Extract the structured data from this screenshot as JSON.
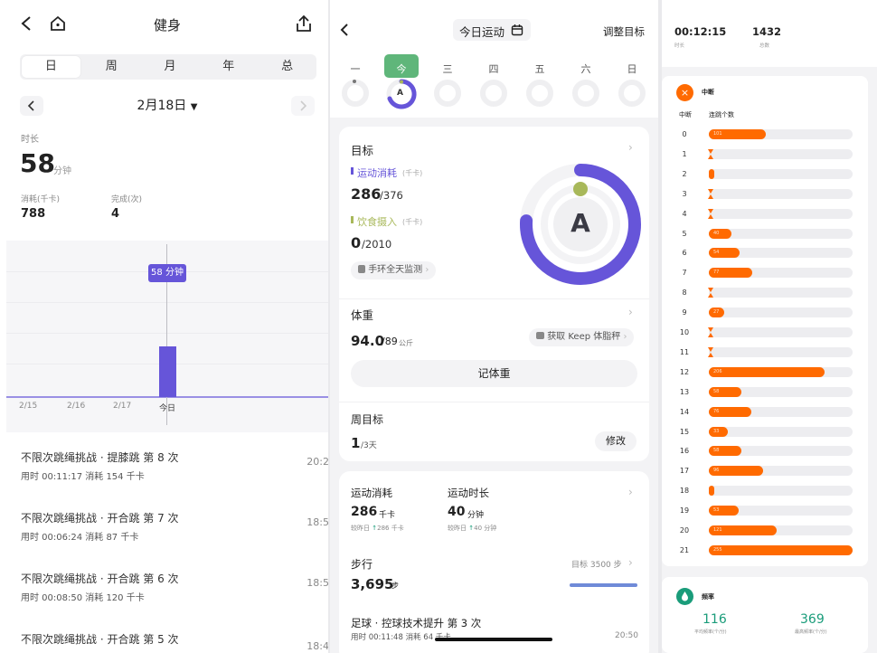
{
  "p1": {
    "title": "健身",
    "tabs": [
      "日",
      "周",
      "月",
      "年",
      "总"
    ],
    "date": "2月18日",
    "duration_label": "时长",
    "duration_value": "58",
    "duration_unit": "分钟",
    "kcal_label": "消耗(千卡)",
    "kcal_value": "788",
    "done_label": "完成(次)",
    "done_value": "4",
    "tooltip": "58 分钟",
    "x_labels": [
      "2/15",
      "2/16",
      "2/17",
      "今日"
    ],
    "records": [
      {
        "title": "不限次跳绳挑战 · 提膝跳 第 8 次",
        "sub": "用时 00:11:17    消耗 154 千卡",
        "time": "20:28"
      },
      {
        "title": "不限次跳绳挑战 · 开合跳 第 7 次",
        "sub": "用时 00:06:24    消耗 87 千卡",
        "time": "18:56"
      },
      {
        "title": "不限次跳绳挑战 · 开合跳 第 6 次",
        "sub": "用时 00:08:50    消耗 120 千卡",
        "time": "18:50"
      },
      {
        "title": "不限次跳绳挑战 · 开合跳 第 5 次",
        "sub": "",
        "time": "18:40"
      }
    ]
  },
  "p2": {
    "title": "今日运动",
    "adjust": "调整目标",
    "weekdays": [
      "一",
      "今",
      "三",
      "四",
      "五",
      "六",
      "日"
    ],
    "ring_letter": "A",
    "goal_title": "目标",
    "burn_label": "运动消耗",
    "burn_unit": "(千卡)",
    "burn_value": "286",
    "burn_target": "/376",
    "intake_label": "饮食摄入",
    "intake_unit": "(千卡)",
    "intake_value": "0",
    "intake_target": "/2010",
    "band_monitor": "手环全天监测",
    "weight_title": "体重",
    "weight_value": "94.0",
    "weight_target": "/89",
    "weight_unit": "公斤",
    "keep_scale": "获取 Keep 体脂秤",
    "record_weight": "记体重",
    "week_goal_title": "周目标",
    "week_goal_value": "1",
    "week_goal_unit": "/3天",
    "modify": "修改",
    "sport_burn_label": "运动消耗",
    "sport_burn_value": "286",
    "sport_burn_unit": "千卡",
    "sport_burn_cmp": "较昨日",
    "sport_burn_delta": "286 千卡",
    "sport_time_label": "运动时长",
    "sport_time_value": "40",
    "sport_time_unit": "分钟",
    "sport_time_cmp": "较昨日",
    "sport_time_delta": "40 分钟",
    "steps_label": "步行",
    "steps_goal": "目标 3500 步",
    "steps_value": "3,695",
    "steps_unit": "步",
    "steps_progress": 1.0,
    "football_title": "足球 · 控球技术提升 第 3 次",
    "football_sub": "用时 00:11:48    消耗 64 千卡",
    "football_time": "20:50",
    "ring_progress_burn": 0.76
  },
  "p3": {
    "duration": "00:12:15",
    "duration_label": "时长",
    "count": "1432",
    "count_label": "总数",
    "break_title": "中断",
    "col_break": "中断",
    "col_count": "连跳个数",
    "bars": [
      {
        "n": "0",
        "v": 101,
        "label": "101"
      },
      {
        "n": "1",
        "v": 0,
        "label": ""
      },
      {
        "n": "2",
        "v": 3,
        "label": ""
      },
      {
        "n": "3",
        "v": 0,
        "label": ""
      },
      {
        "n": "4",
        "v": 0,
        "label": ""
      },
      {
        "n": "5",
        "v": 40,
        "label": "40"
      },
      {
        "n": "6",
        "v": 54,
        "label": "54"
      },
      {
        "n": "7",
        "v": 77,
        "label": "77"
      },
      {
        "n": "8",
        "v": 0,
        "label": ""
      },
      {
        "n": "9",
        "v": 27,
        "label": "27"
      },
      {
        "n": "10",
        "v": 0,
        "label": ""
      },
      {
        "n": "11",
        "v": 0,
        "label": ""
      },
      {
        "n": "12",
        "v": 206,
        "label": "206"
      },
      {
        "n": "13",
        "v": 58,
        "label": "58"
      },
      {
        "n": "14",
        "v": 76,
        "label": "76"
      },
      {
        "n": "15",
        "v": 33,
        "label": "33"
      },
      {
        "n": "16",
        "v": 58,
        "label": "58"
      },
      {
        "n": "17",
        "v": 96,
        "label": "96"
      },
      {
        "n": "18",
        "v": 3,
        "label": ""
      },
      {
        "n": "19",
        "v": 53,
        "label": "53"
      },
      {
        "n": "20",
        "v": 121,
        "label": "121"
      },
      {
        "n": "21",
        "v": 255,
        "label": "255"
      }
    ],
    "freq_title": "频率",
    "avg_freq": "116",
    "avg_freq_label": "平均频率(个/分)",
    "max_freq": "369",
    "max_freq_label": "最高频率(个/分)"
  },
  "colors": {
    "accent_purple": "#6655d9",
    "green_today": "#5fb67a",
    "orange": "#ff6a00",
    "teal": "#1a9c7a",
    "olive": "#a8b85a"
  }
}
